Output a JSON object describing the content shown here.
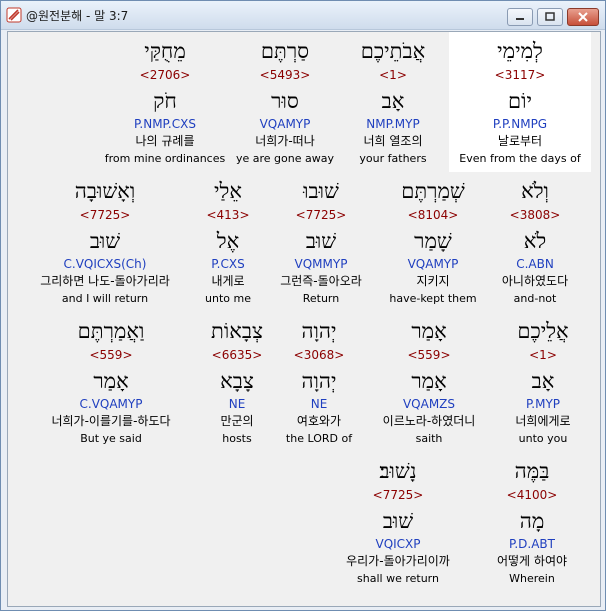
{
  "window": {
    "title": "@원전분해 - 말 3:7"
  },
  "rows": [
    [
      {
        "word": "לְמִימֵי",
        "num": "<3117>",
        "lemma": "יוֹם",
        "parse": "P.P.NMPG",
        "kor": "날로부터",
        "eng": "Even from the days of",
        "selected": true
      },
      {
        "word": "אֲבֹתֵיכֶם",
        "num": "<1>",
        "lemma": "אָב",
        "parse": "NMP.MYP",
        "kor": "너희 열조의",
        "eng": "your fathers"
      },
      {
        "word": "סַרְתֶּם",
        "num": "<5493>",
        "lemma": "סוּר",
        "parse": "VQAMYP",
        "kor": "너희가-떠나",
        "eng": "ye are gone away"
      },
      {
        "word": "מֵחֻקַּי",
        "num": "<2706>",
        "lemma": "חֹק",
        "parse": "P.NMP.CXS",
        "kor": "나의 규례를",
        "eng": "from mine ordinances"
      }
    ],
    [
      {
        "word": "וְלֹא",
        "num": "<3808>",
        "lemma": "לֹא",
        "parse": "C.ABN",
        "kor": "아니하였도다",
        "eng": "and-not"
      },
      {
        "word": "שְׁמַרְתֶּם",
        "num": "<8104>",
        "lemma": "שָׁמַר",
        "parse": "VQAMYP",
        "kor": "지키지",
        "eng": "have-kept them"
      },
      {
        "word": "שׁוּבוּ",
        "num": "<7725>",
        "lemma": "שׁוּב",
        "parse": "VQMMYP",
        "kor": "그런즉-돌아오라",
        "eng": "Return"
      },
      {
        "word": "אֵלַי",
        "num": "<413>",
        "lemma": "אֶל",
        "parse": "P.CXS",
        "kor": "내게로",
        "eng": "unto me"
      },
      {
        "word": "וְאָשׁוּבָה",
        "num": "<7725>",
        "lemma": "שׁוּב",
        "parse": "C.VQICXS(Ch)",
        "kor": "그리하면 나도-돌아가리라",
        "eng": "and I will return"
      }
    ],
    [
      {
        "word": "אֲלֵיכֶם",
        "num": "<1>",
        "lemma": "אָב",
        "parse": "P.MYP",
        "kor": "너희에게로",
        "eng": "unto you"
      },
      {
        "word": "אָמַר",
        "num": "<559>",
        "lemma": "אָמַר",
        "parse": "VQAMZS",
        "kor": "이르노라-하였더니",
        "eng": "saith"
      },
      {
        "word": "יְהוָה",
        "num": "<3068>",
        "lemma": "יְהוָה",
        "parse": "NE",
        "kor": "여호와가",
        "eng": "the LORD of"
      },
      {
        "word": "צְבָאוֹת",
        "num": "<6635>",
        "lemma": "צָבָא",
        "parse": "NE",
        "kor": "만군의",
        "eng": "hosts"
      },
      {
        "word": "וַאֲמַרְתֶּם",
        "num": "<559>",
        "lemma": "אָמַר",
        "parse": "C.VQAMYP",
        "kor": "너희가-이를기를-하도다",
        "eng": "But ye said"
      }
    ],
    [
      {
        "word": "בַּמֶּה",
        "num": "<4100>",
        "lemma": "מָה",
        "parse": "P.D.ABT",
        "kor": "어떻게 하여야",
        "eng": "Wherein"
      },
      {
        "word": "נָשׁוּב׃",
        "num": "<7725>",
        "lemma": "שׁוּב",
        "parse": "VQICXP",
        "kor": "우리가-돌아가리이까",
        "eng": "shall we return"
      }
    ]
  ]
}
